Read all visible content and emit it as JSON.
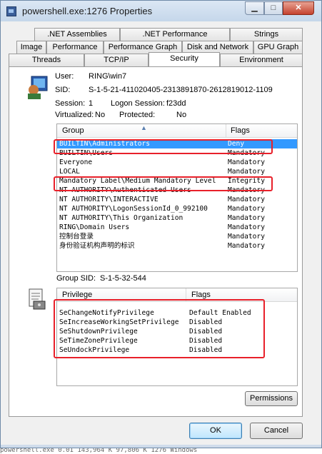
{
  "window": {
    "title": "powershell.exe:1276 Properties"
  },
  "tabs": {
    "row1": [
      ".NET Assemblies",
      ".NET Performance",
      "Strings"
    ],
    "row2": [
      "Image",
      "Performance",
      "Performance Graph",
      "Disk and Network",
      "GPU Graph"
    ],
    "row3": [
      "Threads",
      "TCP/IP",
      "Security",
      "Environment"
    ],
    "active": "Security"
  },
  "user_info": {
    "user_label": "User:",
    "user_value": "RING\\win7",
    "sid_label": "SID:",
    "sid_value": "S-1-5-21-411020405-2313891870-2612819012-1109",
    "session_label": "Session:",
    "session_value": "1",
    "logon_label": "Logon Session:",
    "logon_value": "f23dd",
    "virtualized_label": "Virtualized:",
    "virtualized_value": "No",
    "protected_label": "Protected:",
    "protected_value": "No"
  },
  "groups": {
    "header_group": "Group",
    "header_flags": "Flags",
    "rows": [
      {
        "group": "BUILTIN\\Administrators",
        "flags": "Deny"
      },
      {
        "group": "BUILTIN\\Users",
        "flags": "Mandatory"
      },
      {
        "group": "Everyone",
        "flags": "Mandatory"
      },
      {
        "group": "LOCAL",
        "flags": "Mandatory"
      },
      {
        "group": "Mandatory Label\\Medium Mandatory Level",
        "flags": "Integrity"
      },
      {
        "group": "NT AUTHORITY\\Authenticated Users",
        "flags": "Mandatory"
      },
      {
        "group": "NT AUTHORITY\\INTERACTIVE",
        "flags": "Mandatory"
      },
      {
        "group": "NT AUTHORITY\\LogonSessionId_0_992100",
        "flags": "Mandatory"
      },
      {
        "group": "NT AUTHORITY\\This Organization",
        "flags": "Mandatory"
      },
      {
        "group": "RING\\Domain Users",
        "flags": "Mandatory"
      },
      {
        "group": "控制台登录",
        "flags": "Mandatory"
      },
      {
        "group": "身份验证机构声明的标识",
        "flags": "Mandatory"
      }
    ],
    "group_sid_label": "Group SID:",
    "group_sid_value": "S-1-5-32-544"
  },
  "privileges": {
    "header_privilege": "Privilege",
    "header_flags": "Flags",
    "rows": [
      {
        "privilege": "SeChangeNotifyPrivilege",
        "flags": "Default Enabled"
      },
      {
        "privilege": "SeIncreaseWorkingSetPrivilege",
        "flags": "Disabled"
      },
      {
        "privilege": "SeShutdownPrivilege",
        "flags": "Disabled"
      },
      {
        "privilege": "SeTimeZonePrivilege",
        "flags": "Disabled"
      },
      {
        "privilege": "SeUndockPrivilege",
        "flags": "Disabled"
      }
    ]
  },
  "buttons": {
    "permissions": "Permissions",
    "ok": "OK",
    "cancel": "Cancel"
  },
  "background_strip": "powershell.exe        0.01      143,964 K     97,806 K  1276 Windows"
}
